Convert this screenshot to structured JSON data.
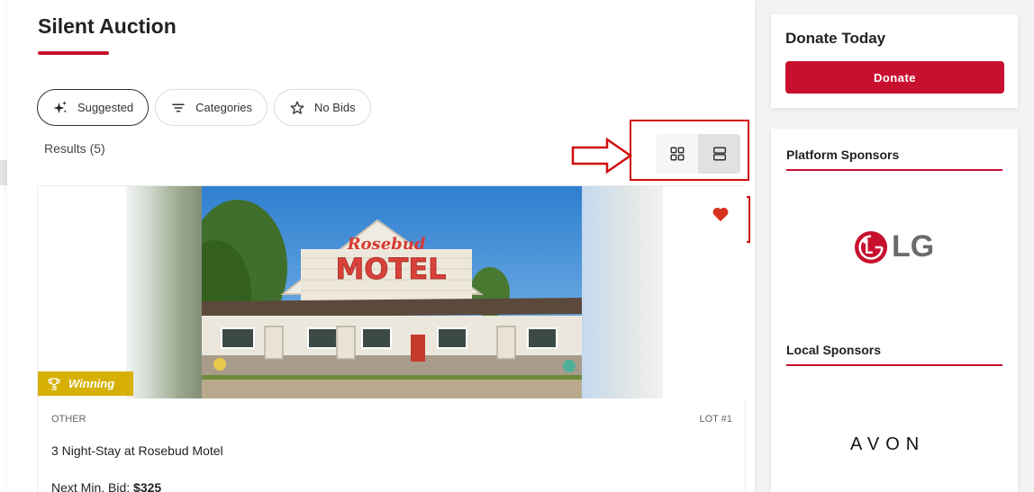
{
  "page": {
    "title": "Silent Auction"
  },
  "filters": [
    {
      "label": "Suggested",
      "icon": "sparkle-icon",
      "active": true
    },
    {
      "label": "Categories",
      "icon": "filter-lines-icon",
      "active": false
    },
    {
      "label": "No Bids",
      "icon": "star-outline-icon",
      "active": false
    }
  ],
  "results": {
    "label": "Results (5)"
  },
  "view_toggle": {
    "options": [
      "grid-view-icon",
      "list-view-icon"
    ],
    "selected": "list-view-icon"
  },
  "item": {
    "badge": "Winning",
    "category": "OTHER",
    "lot": "LOT #1",
    "title": "3 Night-Stay at Rosebud Motel",
    "next_bid_label": "Next Min. Bid:",
    "next_bid_value": "$325",
    "photo_sign_script": "Rosebud",
    "photo_sign_main": "MOTEL",
    "favorite": true
  },
  "donate": {
    "title": "Donate Today",
    "button": "Donate"
  },
  "sponsors": {
    "platform_heading": "Platform Sponsors",
    "platform_logo_text": "LG",
    "local_heading": "Local Sponsors",
    "local_logo_text": "AVON"
  },
  "colors": {
    "brand_red": "#c8102e",
    "annotation_red": "#d10d0d",
    "winning_gold": "#d6b006",
    "lg_red": "#c8102e"
  }
}
